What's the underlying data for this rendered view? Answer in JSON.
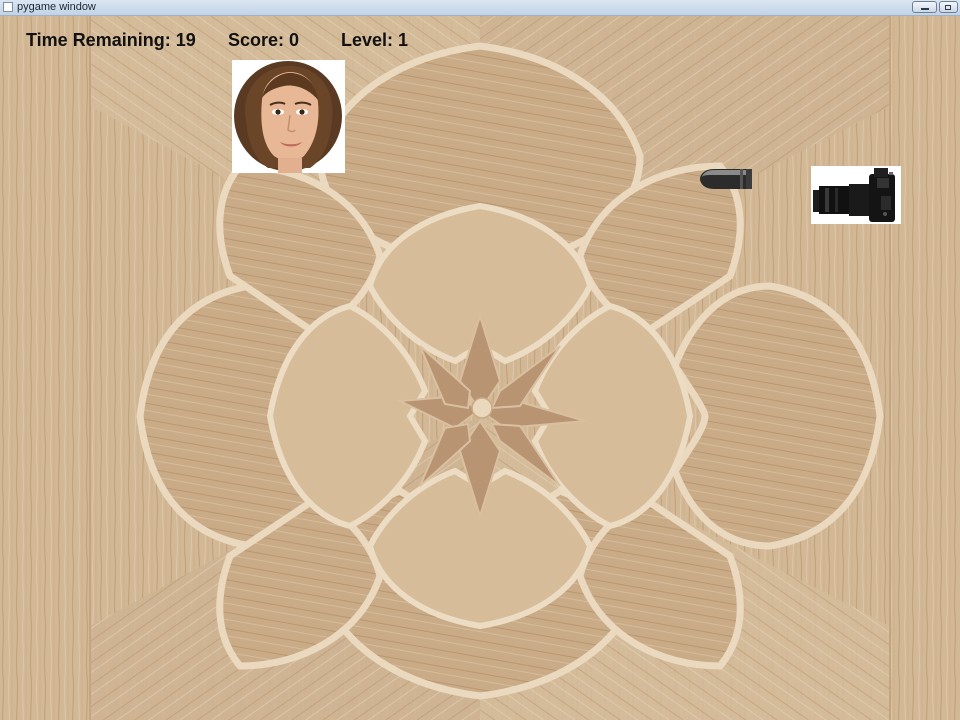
{
  "window": {
    "title": "pygame window",
    "app_icon": "pygame-window-icon",
    "buttons": [
      "minimize-icon",
      "restore-icon"
    ]
  },
  "hud": {
    "time_label": "Time Remaining: ",
    "time_value": 19,
    "score_label": "Score: ",
    "score_value": 0,
    "level_label": "Level: ",
    "level_value": 1
  },
  "sprites": {
    "target": "face-portrait-target",
    "projectile": "bullet-icon",
    "shooter": "camera-icon"
  },
  "colors": {
    "background_wood": "#d6bd9c",
    "wood_dark": "#b89472",
    "wood_light": "#e8d6bd",
    "hud_text": "#111111"
  }
}
